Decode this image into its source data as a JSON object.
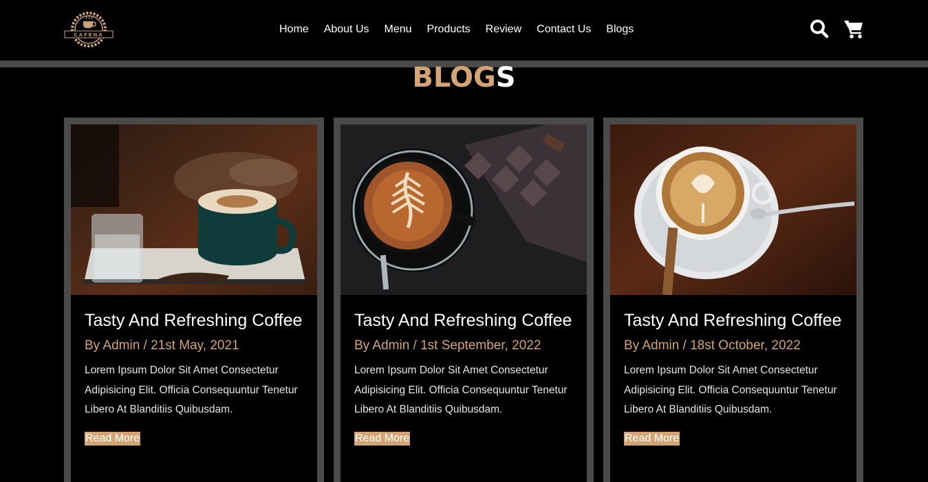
{
  "brand": {
    "logo_text": "CAFENA"
  },
  "nav": [
    {
      "label": "Home"
    },
    {
      "label": "About Us"
    },
    {
      "label": "Menu"
    },
    {
      "label": "Products"
    },
    {
      "label": "Review"
    },
    {
      "label": "Contact Us"
    },
    {
      "label": "Blogs"
    }
  ],
  "icons": {
    "search": "search-icon",
    "cart": "cart-icon"
  },
  "section": {
    "title_accent": "BLOG",
    "title_plain": "S"
  },
  "colors": {
    "accent": "#d3a574",
    "frame": "#4a4a4a",
    "background": "#000000"
  },
  "blogs": [
    {
      "title": "Tasty And Refreshing Coffee",
      "meta": "By Admin / 21st May, 2021",
      "description": "Lorem Ipsum Dolor Sit Amet Consectetur Adipisicing Elit. Officia Consequuntur Tenetur Libero At Blanditiis Quibusdam.",
      "read_more": "Read More"
    },
    {
      "title": "Tasty And Refreshing Coffee",
      "meta": "By Admin / 1st September, 2022",
      "description": "Lorem Ipsum Dolor Sit Amet Consectetur Adipisicing Elit. Officia Consequuntur Tenetur Libero At Blanditiis Quibusdam.",
      "read_more": "Read More"
    },
    {
      "title": "Tasty And Refreshing Coffee",
      "meta": "By Admin / 18st October, 2022",
      "description": "Lorem Ipsum Dolor Sit Amet Consectetur Adipisicing Elit. Officia Consequuntur Tenetur Libero At Blanditiis Quibusdam.",
      "read_more": "Read More"
    }
  ]
}
